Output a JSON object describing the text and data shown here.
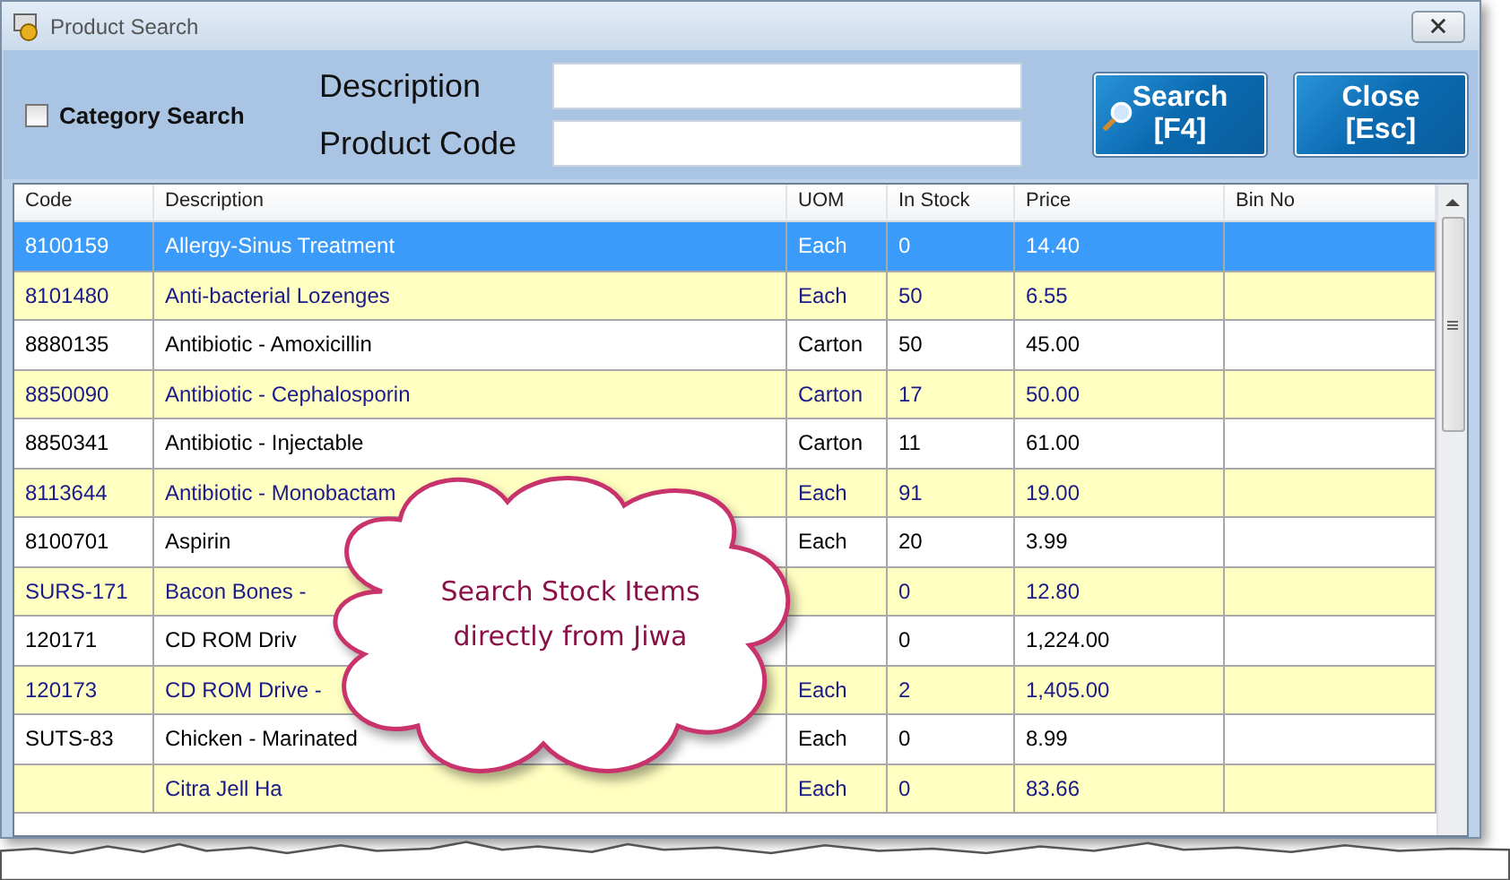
{
  "window": {
    "title": "Product Search"
  },
  "filters": {
    "category_search": {
      "label": "Category Search",
      "checked": false
    },
    "fields": [
      {
        "label": "Description"
      },
      {
        "label": "Product Code"
      }
    ]
  },
  "buttons": [
    {
      "kind": "search",
      "lines": [
        "Search",
        "[F4]"
      ]
    },
    {
      "kind": "close",
      "lines": [
        "Close",
        "[Esc]"
      ]
    }
  ],
  "table": {
    "columns": [
      "Code",
      "Description",
      "UOM",
      "In Stock",
      "Price",
      "Bin No"
    ],
    "rows": [
      {
        "selected": true,
        "cells": [
          "8100159",
          "Allergy-Sinus Treatment",
          "Each",
          "0",
          "14.40"
        ]
      },
      {
        "selected": false,
        "cells": [
          "8101480",
          "Anti-bacterial Lozenges",
          "Each",
          "50",
          "6.55"
        ]
      },
      {
        "selected": false,
        "cells": [
          "8880135",
          "Antibiotic - Amoxicillin",
          "Carton",
          "50",
          "45.00"
        ]
      },
      {
        "selected": false,
        "cells": [
          "8850090",
          "Antibiotic - Cephalosporin",
          "Carton",
          "17",
          "50.00"
        ]
      },
      {
        "selected": false,
        "cells": [
          "8850341",
          "Antibiotic - Injectable",
          "Carton",
          "11",
          "61.00"
        ]
      },
      {
        "selected": false,
        "cells": [
          "8113644",
          "Antibiotic - Monobactam",
          "Each",
          "91",
          "19.00"
        ]
      },
      {
        "selected": false,
        "cells": [
          "8100701",
          "Aspirin",
          "Each",
          "20",
          "3.99"
        ]
      },
      {
        "selected": false,
        "cells": [
          "SURS-171",
          "Bacon Bones -",
          "",
          "0",
          "12.80"
        ]
      },
      {
        "selected": false,
        "cells": [
          "120171",
          "CD ROM Driv",
          "",
          "0",
          "1,224.00"
        ]
      },
      {
        "selected": false,
        "cells": [
          "120173",
          "CD ROM Drive -",
          "Each",
          "2",
          "1,405.00"
        ]
      },
      {
        "selected": false,
        "cells": [
          "SUTS-83",
          "Chicken - Marinated",
          "Each",
          "0",
          "8.99"
        ]
      },
      {
        "selected": false,
        "cells": [
          "",
          "Citra Jell Ha",
          "Each",
          "0",
          "83.66"
        ]
      }
    ]
  },
  "callout": {
    "text": "Search Stock Items directly from Jiwa"
  }
}
